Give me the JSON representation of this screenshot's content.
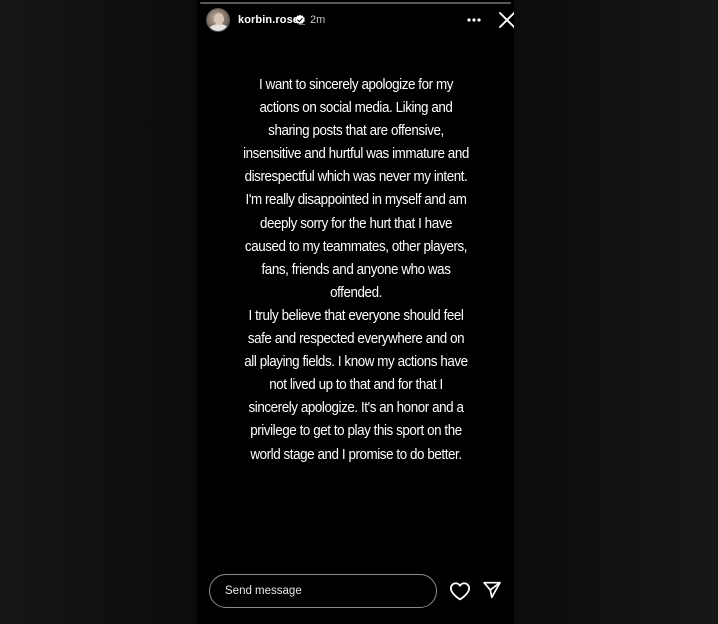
{
  "story": {
    "username": "korbin.rose_",
    "timestamp": "2m",
    "progress_fraction": 0.0,
    "statement": {
      "paragraph_1": "I want to sincerely apologize for my\nactions on social media. Liking and\nsharing posts that are offensive,\ninsensitive and hurtful was immature and\ndisrespectful which was never my intent.\nI'm really disappointed in myself and am\ndeeply sorry for the hurt that I have\ncaused to my teammates, other players,\nfans, friends and anyone who was\noffended.",
      "paragraph_2": "I truly believe that everyone should feel\nsafe and respected everywhere and on\nall playing fields. I know my actions have\nnot lived up to that and for that I\nsincerely apologize. It's an honor and a\nprivilege to get to play this sport on the\nworld stage and I promise to do better."
    }
  },
  "footer": {
    "message_placeholder": "Send message",
    "message_value": ""
  },
  "icons": {
    "verified": "verified-badge-icon",
    "more": "more-options-icon",
    "close": "close-icon",
    "heart": "heart-icon",
    "share": "send-icon"
  },
  "colors": {
    "story_background": "#000000",
    "page_background": "#111111",
    "text": "#ffffff",
    "verified_badge": "#ffffff"
  }
}
